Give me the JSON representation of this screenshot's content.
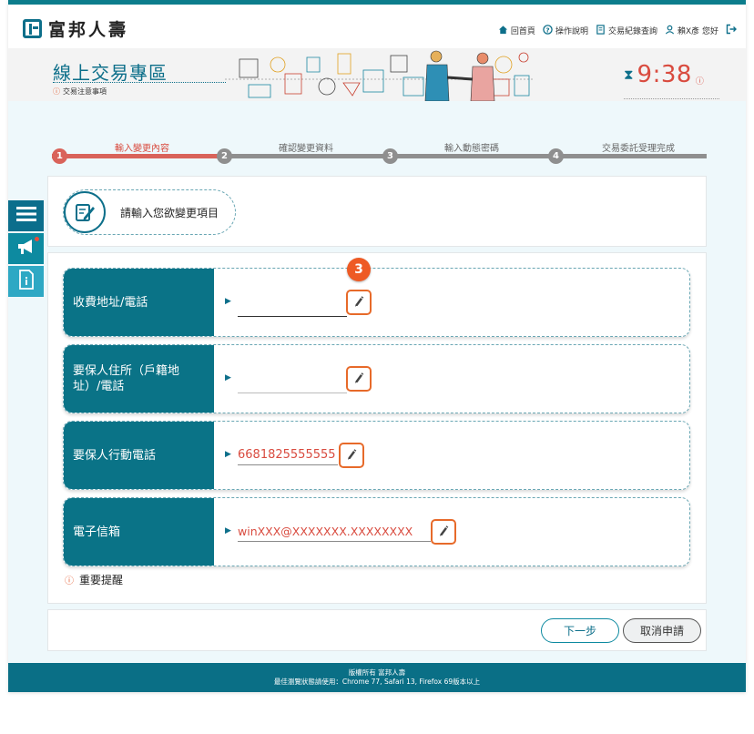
{
  "header": {
    "logo_text": "富邦人壽",
    "nav": [
      {
        "icon": "home-icon",
        "label": "回首頁"
      },
      {
        "icon": "help-icon",
        "label": "操作說明"
      },
      {
        "icon": "record-icon",
        "label": "交易紀錄查詢"
      },
      {
        "icon": "user-icon",
        "label": "賴X彥 您好"
      }
    ],
    "logout_icon": "logout-icon"
  },
  "banner": {
    "title": "線上交易專區",
    "note": "交易注意事項",
    "timer": "9:38"
  },
  "steps": [
    {
      "num": "1",
      "label": "輸入變更內容",
      "active": true
    },
    {
      "num": "2",
      "label": "確認變更資料",
      "active": false
    },
    {
      "num": "3",
      "label": "輸入動態密碼",
      "active": false
    },
    {
      "num": "4",
      "label": "交易委託受理完成",
      "active": false
    }
  ],
  "prompt": {
    "text": "請輸入您欲變更項目"
  },
  "badge": "3",
  "rows": [
    {
      "label": "收費地址/電話",
      "value": ""
    },
    {
      "label": "要保人住所（戶籍地址）/電話",
      "value": ""
    },
    {
      "label": "要保人行動電話",
      "value": "6681825555555"
    },
    {
      "label": "電子信箱",
      "value": "winXXX@XXXXXXX.XXXXXXXX"
    }
  ],
  "important": "重要提醒",
  "buttons": {
    "next": "下一步",
    "cancel": "取消申請"
  },
  "footer": {
    "line1": "版權所有 富邦人壽",
    "line2": "最佳瀏覽狀態請使用：Chrome 77, Safari 13, Firefox 69版本以上"
  },
  "colors": {
    "primary": "#0a7387",
    "accent": "#d94b3f",
    "badge": "#ee5a24"
  }
}
